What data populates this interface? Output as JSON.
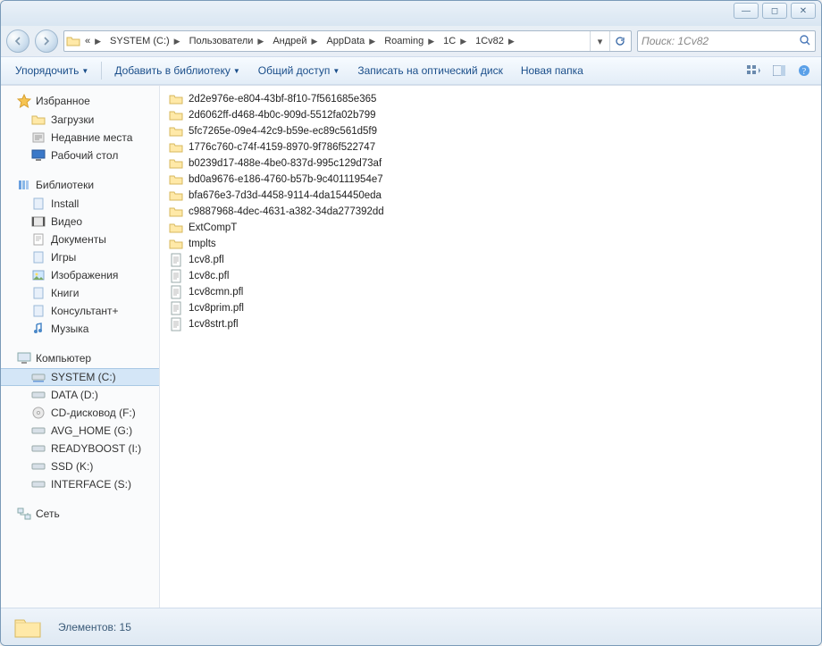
{
  "window_controls": {
    "min": "—",
    "max": "◻",
    "close": "✕"
  },
  "breadcrumbs": {
    "prefix": "«",
    "items": [
      "SYSTEM (C:)",
      "Пользователи",
      "Андрей",
      "AppData",
      "Roaming",
      "1C",
      "1Cv82"
    ]
  },
  "search": {
    "placeholder": "Поиск: 1Cv82"
  },
  "toolbar": {
    "organize": "Упорядочить",
    "add_library": "Добавить в библиотеку",
    "share": "Общий доступ",
    "burn": "Записать на оптический диск",
    "new_folder": "Новая папка"
  },
  "sidebar": {
    "favorites": {
      "label": "Избранное",
      "items": [
        "Загрузки",
        "Недавние места",
        "Рабочий стол"
      ]
    },
    "libraries": {
      "label": "Библиотеки",
      "items": [
        "Install",
        "Видео",
        "Документы",
        "Игры",
        "Изображения",
        "Книги",
        "Консультант+",
        "Музыка"
      ]
    },
    "computer": {
      "label": "Компьютер",
      "items": [
        "SYSTEM (C:)",
        "DATA (D:)",
        "CD-дисковод (F:)",
        "AVG_HOME (G:)",
        "READYBOOST (I:)",
        "SSD (K:)",
        "INTERFACE (S:)"
      ]
    },
    "network": {
      "label": "Сеть"
    }
  },
  "files": {
    "folders": [
      "2d2e976e-e804-43bf-8f10-7f561685e365",
      "2d6062ff-d468-4b0c-909d-5512fa02b799",
      "5fc7265e-09e4-42c9-b59e-ec89c561d5f9",
      "1776c760-c74f-4159-8970-9f786f522747",
      "b0239d17-488e-4be0-837d-995c129d73af",
      "bd0a9676-e186-4760-b57b-9c40111954e7",
      "bfa676e3-7d3d-4458-9114-4da154450eda",
      "c9887968-4dec-4631-a382-34da277392dd",
      "ExtCompT",
      "tmplts"
    ],
    "docs": [
      "1cv8.pfl",
      "1cv8c.pfl",
      "1cv8cmn.pfl",
      "1cv8prim.pfl",
      "1cv8strt.pfl"
    ]
  },
  "status": {
    "count_label": "Элементов: 15"
  }
}
